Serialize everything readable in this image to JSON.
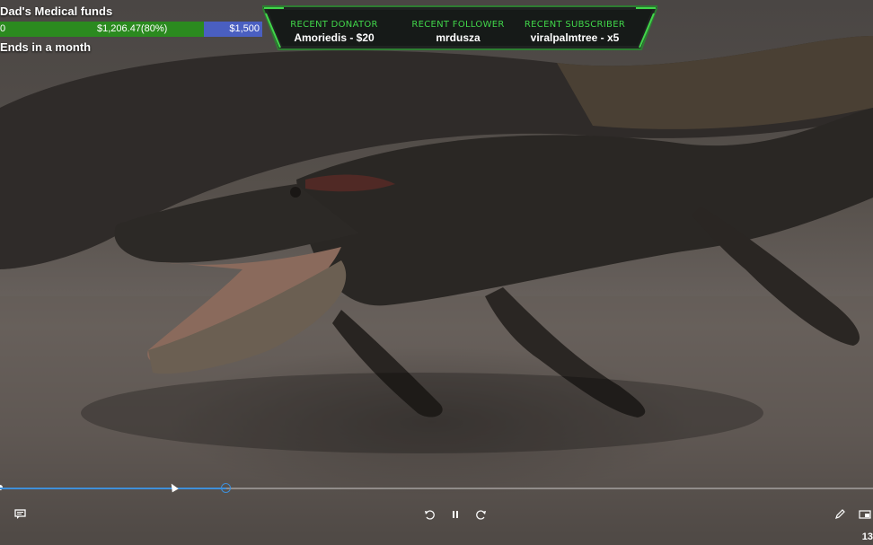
{
  "goal": {
    "title": "Dad's Medical funds",
    "start_value": "0",
    "current_value": "$1,206.47(80%)",
    "target_value": "$1,500",
    "progress_percent": 80,
    "ends_text": "Ends in a month",
    "fill_color": "#2b8a1f",
    "bar_color": "#4a5fc1"
  },
  "banner": {
    "accent_color": "#41d64a",
    "items": [
      {
        "label": "RECENT DONATOR",
        "value": "Amoriedis - $20"
      },
      {
        "label": "RECENT FOLLOWER",
        "value": "mrdusza"
      },
      {
        "label": "RECENT SUBSCRIBER",
        "value": "viralpalmtree - x5"
      }
    ]
  },
  "player": {
    "played_fraction": 0.259,
    "progress_color": "#3f8fd9",
    "timecode": "13",
    "controls": [
      "chat-icon",
      "rewind-10-icon",
      "pause-icon",
      "forward-30-icon",
      "edit-icon",
      "miniplayer-icon"
    ]
  }
}
